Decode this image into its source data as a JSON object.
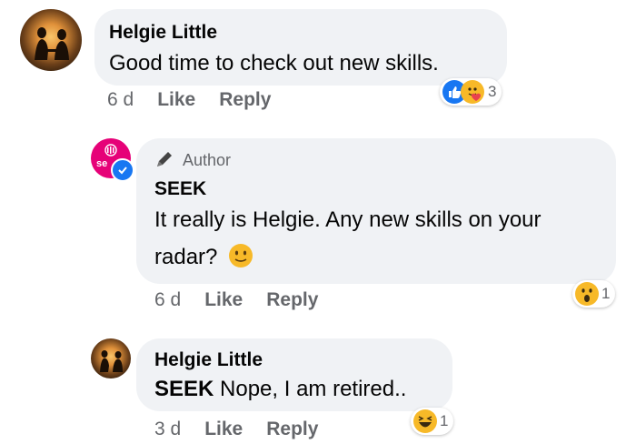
{
  "comments": [
    {
      "author": "Helgie Little",
      "text": "Good time to check out new skills.",
      "time": "6 d",
      "like_label": "Like",
      "reply_label": "Reply",
      "reaction_icons": [
        "like-icon",
        "care-icon"
      ],
      "reaction_count": "3"
    },
    {
      "badge": "Author",
      "author": "SEEK",
      "text_line1": "It really is Helgie. Any new skills on your",
      "text_line2": "radar?",
      "time": "6 d",
      "like_label": "Like",
      "reply_label": "Reply",
      "reaction_icons": [
        "wow-icon"
      ],
      "reaction_count": "1",
      "logo_text": "se"
    },
    {
      "author": "Helgie Little",
      "tag": "SEEK",
      "text": " Nope, I am retired..",
      "time": "3 d",
      "like_label": "Like",
      "reply_label": "Reply",
      "reaction_icons": [
        "haha-icon"
      ],
      "reaction_count": "1"
    }
  ],
  "colors": {
    "bubble": "#f0f2f5",
    "meta": "#65676b",
    "like_blue": "#1877f2",
    "seek_pink": "#e60278",
    "emoji_yellow": "#f7b928"
  }
}
